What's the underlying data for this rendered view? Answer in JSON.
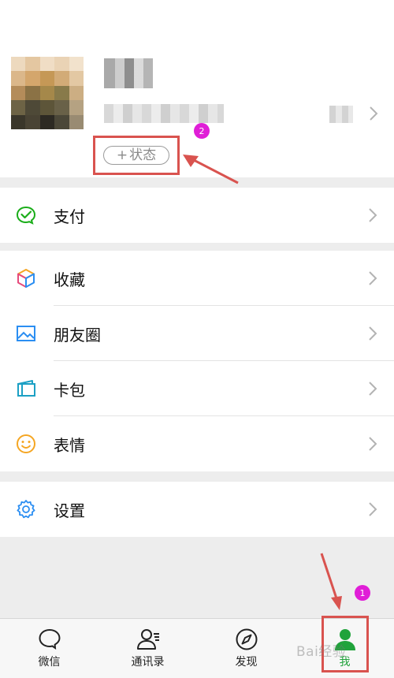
{
  "profile": {
    "status_plus": "+",
    "status_label": "状态",
    "annotation_badge": "2"
  },
  "menu": {
    "pay": "支付",
    "favorites": "收藏",
    "moments": "朋友圈",
    "cards": "卡包",
    "stickers": "表情",
    "settings": "设置"
  },
  "tabbar": {
    "tabs": [
      {
        "label": "微信",
        "icon": "chat-bubble-icon"
      },
      {
        "label": "通讯录",
        "icon": "contacts-icon"
      },
      {
        "label": "发现",
        "icon": "compass-icon"
      },
      {
        "label": "我",
        "icon": "me-person-icon",
        "active": true
      }
    ],
    "annotation_badge": "1"
  },
  "watermark": "Bai经验",
  "colors": {
    "accent_green": "#20a33b",
    "annotation_red": "#d9534f",
    "badge_magenta": "#e01ed7"
  }
}
